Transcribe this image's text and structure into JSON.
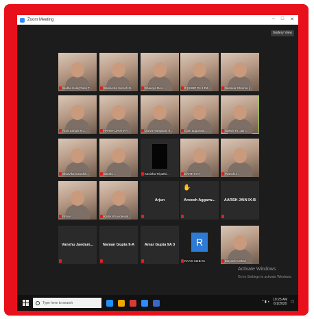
{
  "window": {
    "title": "Zoom Meeting",
    "controls": [
      "–",
      "□",
      "✕"
    ],
    "gallery_button": "Gallery View"
  },
  "participants": [
    {
      "name": "Sudha Kale(Class T...",
      "type": "video"
    },
    {
      "name": "Samiksha Suresh N...",
      "type": "video"
    },
    {
      "name": "Shaurya Dev ...",
      "type": "video"
    },
    {
      "name": "2 (SSBP Ps 1 Dd...",
      "type": "video"
    },
    {
      "name": "Sanskar Sharma (...",
      "type": "video"
    },
    {
      "name": "Arpit Sanghi 9-J...",
      "type": "video"
    },
    {
      "name": "HARSH JAIN 9-A",
      "type": "video"
    },
    {
      "name": "Garvit Rangwani 9...",
      "type": "video"
    },
    {
      "name": "Gian aggarwal...",
      "type": "video"
    },
    {
      "name": "Sakshi Kr. Jain...",
      "type": "video",
      "active": true
    },
    {
      "name": "Sharvika Kowshik...",
      "type": "video"
    },
    {
      "name": "Sakshi ...",
      "type": "video"
    },
    {
      "name": "Kavisha Tripathi...",
      "type": "black"
    },
    {
      "name": "EARTH 9-A",
      "type": "video"
    },
    {
      "name": "Pranshul ...",
      "type": "video"
    },
    {
      "name": "Prince ...",
      "type": "video"
    },
    {
      "name": "Kartik Khandelwal...",
      "type": "video"
    },
    {
      "name": "Arjun",
      "type": "blank"
    },
    {
      "name": "Anvesh Aggarw...",
      "type": "blank",
      "hand": true
    },
    {
      "name": "AARSH JAIN IX-B",
      "type": "blank"
    },
    {
      "name": "Vanshu Jaedam...",
      "type": "blank"
    },
    {
      "name": "Naman Gupta 9-A",
      "type": "blank"
    },
    {
      "name": "Amar Gupta 9A 3",
      "type": "blank"
    },
    {
      "name": "RAAS-111B-01",
      "type": "avatar",
      "initial": "R"
    },
    {
      "name": "Mayank Kothari",
      "type": "video"
    }
  ],
  "watermark": {
    "line1": "Activate Windows",
    "line2": "Go to Settings to activate Windows."
  },
  "taskbar": {
    "search_placeholder": "Type here to search",
    "time": "10:25 AM",
    "date": "6/1/2020",
    "app_colors": [
      "#1e90ff",
      "#f0a500",
      "#d63b3b",
      "#2d8cff",
      "#3a66c4"
    ]
  },
  "colors": {
    "frame": "#e8111b",
    "active_speaker": "#9bd34a",
    "mic_muted": "#e02020"
  }
}
